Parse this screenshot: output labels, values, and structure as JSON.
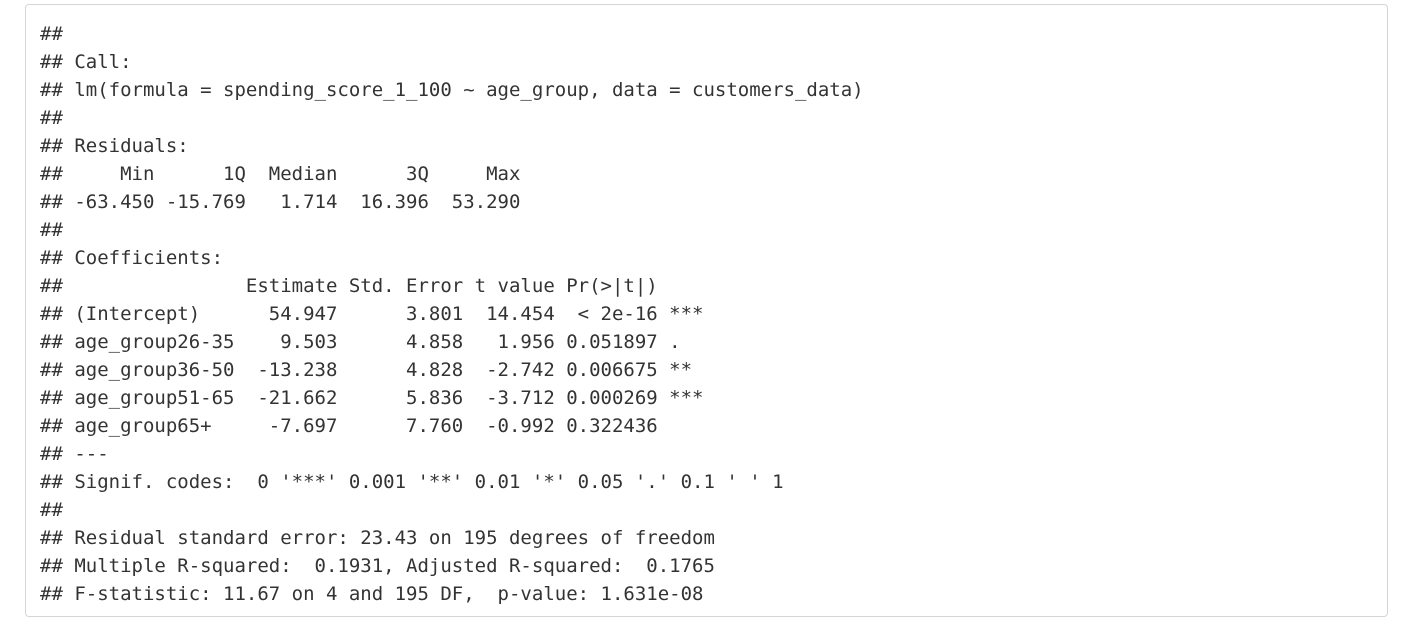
{
  "output": {
    "lines": [
      "##",
      "## Call:",
      "## lm(formula = spending_score_1_100 ~ age_group, data = customers_data)",
      "##",
      "## Residuals:",
      "##     Min      1Q  Median      3Q     Max",
      "## -63.450 -15.769   1.714  16.396  53.290",
      "##",
      "## Coefficients:",
      "##                Estimate Std. Error t value Pr(>|t|)",
      "## (Intercept)      54.947      3.801  14.454  < 2e-16 ***",
      "## age_group26-35    9.503      4.858   1.956 0.051897 .",
      "## age_group36-50  -13.238      4.828  -2.742 0.006675 **",
      "## age_group51-65  -21.662      5.836  -3.712 0.000269 ***",
      "## age_group65+     -7.697      7.760  -0.992 0.322436",
      "## ---",
      "## Signif. codes:  0 '***' 0.001 '**' 0.01 '*' 0.05 '.' 0.1 ' ' 1",
      "##",
      "## Residual standard error: 23.43 on 195 degrees of freedom",
      "## Multiple R-squared:  0.1931, Adjusted R-squared:  0.1765",
      "## F-statistic: 11.67 on 4 and 195 DF,  p-value: 1.631e-08"
    ]
  }
}
